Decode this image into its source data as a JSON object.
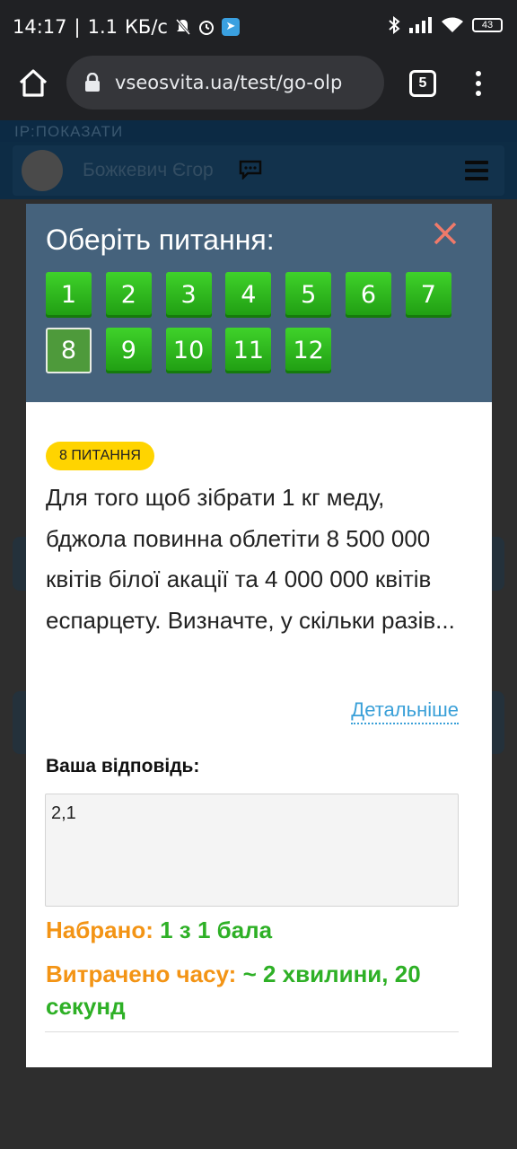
{
  "status_bar": {
    "time": "14:17",
    "speed": "1.1",
    "speed_unit": "КБ/с",
    "battery": "43"
  },
  "browser": {
    "url": "vseosvita.ua/test/go-olp",
    "tab_count": "5"
  },
  "background_page": {
    "ip_label": "IP:ПОКАЗАТИ",
    "user_name": "Божкевич Єгор"
  },
  "modal": {
    "title": "Оберіть питання:",
    "questions": [
      "1",
      "2",
      "3",
      "4",
      "5",
      "6",
      "7",
      "8",
      "9",
      "10",
      "11",
      "12"
    ],
    "active_question": "8",
    "badge": "8 ПИТАННЯ",
    "question_text": "Для того щоб зібрати 1 кг меду, бджола повинна облетіти 8 500 000 квітів білої акації та 4 000 000 квітів еспарцету. Визначте, у скільки разів...",
    "more_link": "Детальніше",
    "answer_label": "Ваша відповідь:",
    "answer_value": "2,1",
    "score_label": "Набрано:",
    "score_value": "1 з 1 бала",
    "time_label": "Витрачено часу:",
    "time_value": "~ 2 хвилини, 20 секунд"
  },
  "colors": {
    "modal_header": "#45627c",
    "question_button": "#2fb61c",
    "badge": "#ffd400",
    "link": "#3aa0d8",
    "orange_label": "#f39415",
    "green_value": "#2eb026",
    "close": "#f07a6a"
  }
}
